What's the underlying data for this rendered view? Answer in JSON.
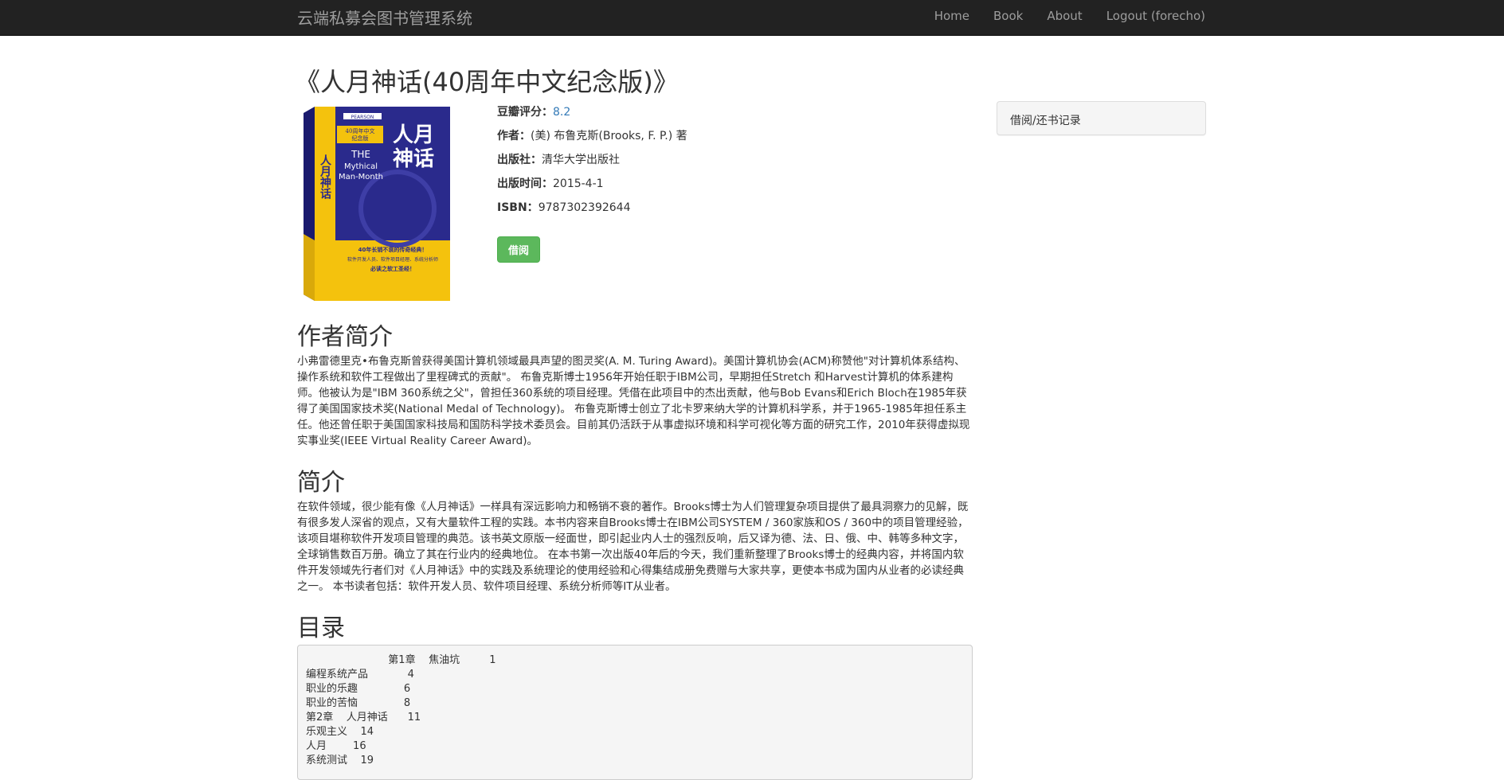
{
  "navbar": {
    "brand": "云端私募会图书管理系统",
    "links": [
      "Home",
      "Book",
      "About",
      "Logout (forecho)"
    ]
  },
  "book": {
    "title": "《人月神话(40周年中文纪念版)》",
    "cover": {
      "badge": "PEARSON",
      "cn_title_lines": [
        "人月",
        "神话"
      ],
      "edition_lines": [
        "40周年中文",
        "纪念版"
      ],
      "en_title_lines": [
        "THE",
        "Mythical",
        "Man-Month"
      ],
      "tagline_lines": [
        "40年长销不衰的传奇经典！",
        "软件开发人员、软件项目经理、系统分析师",
        "必读之软工圣经！"
      ],
      "spine": "人月神话"
    },
    "meta": [
      {
        "label": "豆瓣评分：",
        "value": "8.2"
      },
      {
        "label": "作者：",
        "value": "(美) 布鲁克斯(Brooks, F. P.) 著"
      },
      {
        "label": "出版社：",
        "value": "清华大学出版社"
      },
      {
        "label": "出版时间：",
        "value": "2015-4-1"
      },
      {
        "label": "ISBN：",
        "value": "9787302392644"
      }
    ],
    "borrow_button": "借阅"
  },
  "sidebar": {
    "panel_title": "借阅/还书记录"
  },
  "sections": {
    "author_heading": "作者简介",
    "author_text": "小弗雷德里克•布鲁克斯曾获得美国计算机领域最具声望的图灵奖(A. M. Turing Award)。美国计算机协会(ACM)称赞他\"对计算机体系结构、操作系统和软件工程做出了里程碑式的贡献\"。 布鲁克斯博士1956年开始任职于IBM公司，早期担任Stretch 和Harvest计算机的体系建构师。他被认为是\"IBM 360系统之父\"，曾担任360系统的项目经理。凭借在此项目中的杰出贡献，他与Bob Evans和Erich Bloch在1985年获得了美国国家技术奖(National Medal of Technology)。 布鲁克斯博士创立了北卡罗来纳大学的计算机科学系，并于1965-1985年担任系主任。他还曾任职于美国国家科技局和国防科学技术委员会。目前其仍活跃于从事虚拟环境和科学可视化等方面的研究工作，2010年获得虚拟现实事业奖(IEEE Virtual Reality Career Award)。",
    "summary_heading": "简介",
    "summary_text": "在软件领域，很少能有像《人月神话》一样具有深远影响力和畅销不衰的著作。Brooks博士为人们管理复杂项目提供了最具洞察力的见解，既有很多发人深省的观点，又有大量软件工程的实践。本书内容来自Brooks博士在IBM公司SYSTEM / 360家族和OS / 360中的项目管理经验，该项目堪称软件开发项目管理的典范。该书英文原版一经面世，即引起业内人士的强烈反响，后又译为德、法、日、俄、中、韩等多种文字，全球销售数百万册。确立了其在行业内的经典地位。 在本书第一次出版40年后的今天，我们重新整理了Brooks博士的经典内容，并将国内软件开发领域先行者们对《人月神话》中的实践及系统理论的使用经验和心得集结成册免费赠与大家共享，更使本书成为国内从业者的必读经典之一。 本书读者包括：软件开发人员、软件项目经理、系统分析师等IT从业者。",
    "toc_heading": "目录",
    "toc_text": "                         第1章    焦油坑         1\n编程系统产品            4\n职业的乐趣              6\n职业的苦恼              8\n第2章    人月神话      11\n乐观主义    14\n人月        16\n系统测试    19"
  },
  "colors": {
    "navbar_bg": "#222222",
    "nav_text": "#9d9d9d",
    "link": "#337ab7",
    "success": "#5cb85c",
    "panel_bg": "#f5f5f5"
  }
}
